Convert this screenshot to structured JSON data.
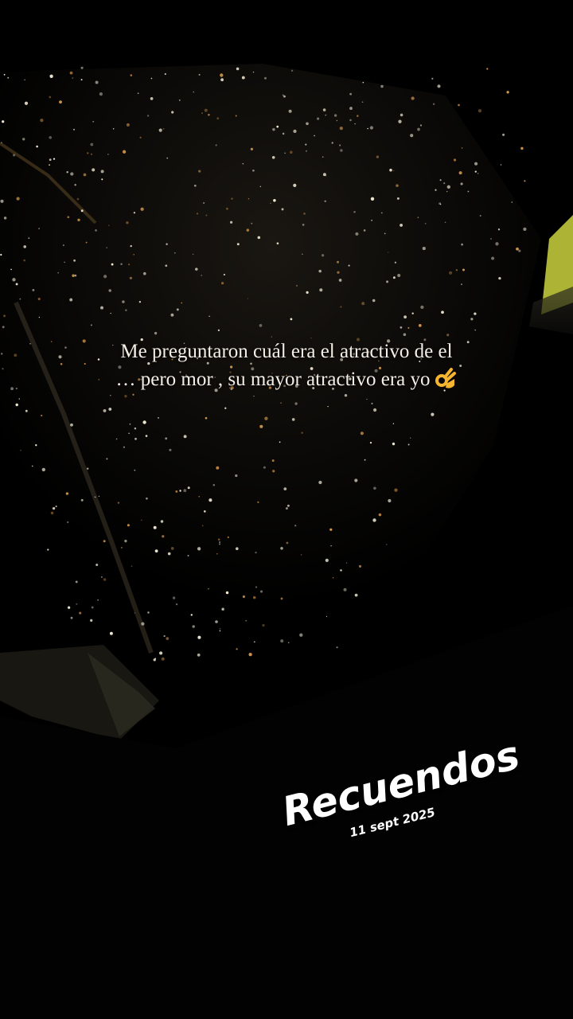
{
  "story": {
    "caption_line1": "Me preguntaron cuál era el atractivo de el",
    "caption_line2": "… pero mor , su mayor atractivo era yo",
    "caption_emoji": "ok-hand-icon",
    "sticker_title": "Recuendos",
    "sticker_date": "11 sept 2025"
  },
  "colors": {
    "background": "#000000",
    "caption_text": "#f4efe6",
    "city_light_warm": "#e0a050",
    "city_light_white": "#fff7e0",
    "wing_tip": "#d8e24a"
  }
}
